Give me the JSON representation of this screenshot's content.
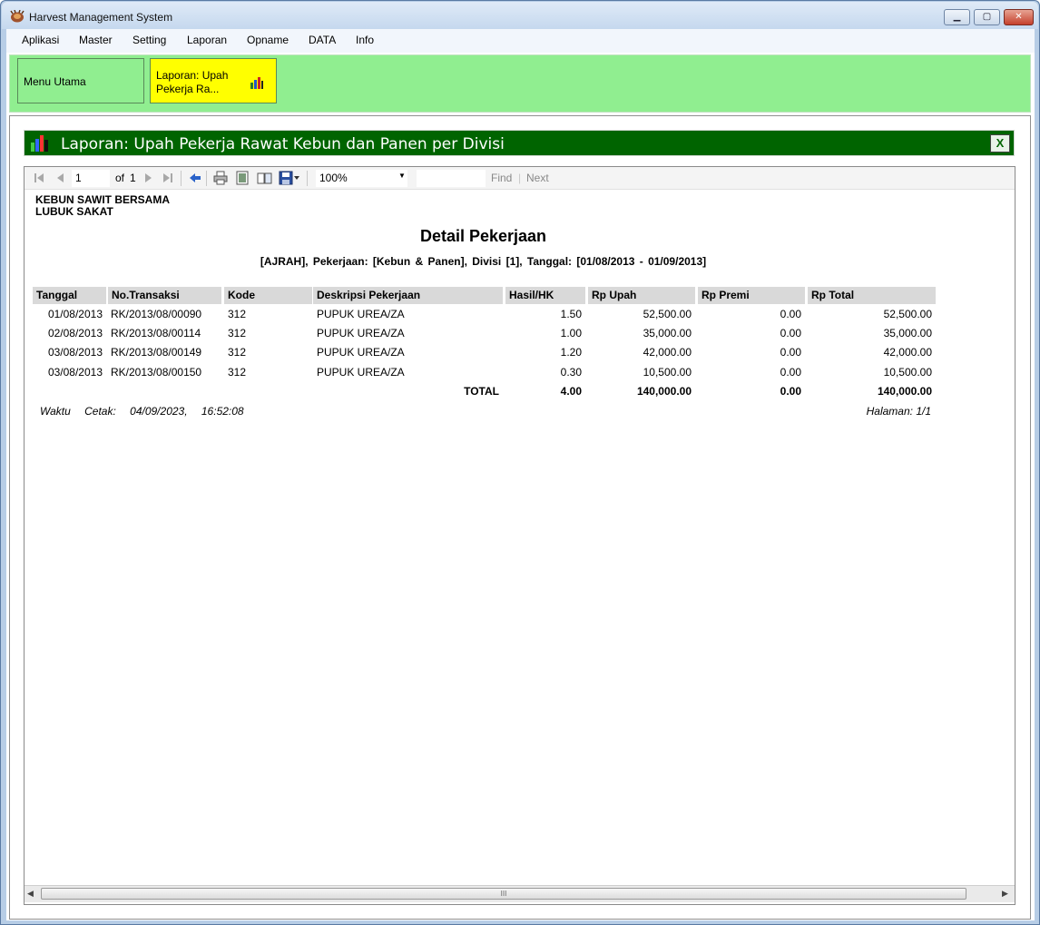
{
  "window": {
    "title": "Harvest Management System",
    "minimize_label": "▁",
    "maximize_label": "▢",
    "close_label": "✕"
  },
  "menu": [
    "Aplikasi",
    "Master",
    "Setting",
    "Laporan",
    "Opname",
    "DATA",
    "Info"
  ],
  "tabs": {
    "home": "Menu Utama",
    "report": "Laporan: Upah Pekerja Ra..."
  },
  "report_form": {
    "title": "Laporan: Upah Pekerja Rawat Kebun dan Panen per Divisi",
    "close_label": "X"
  },
  "toolbar": {
    "page": "1",
    "of_label": "of",
    "total_pages": "1",
    "zoom": "100%",
    "find_label": "Find",
    "next_label": "Next",
    "separator": "|"
  },
  "report": {
    "company": "KEBUN SAWIT BERSAMA",
    "location": "LUBUK SAKAT",
    "title": "Detail Pekerjaan",
    "subtitle": "[AJRAH], Pekerjaan: [Kebun & Panen], Divisi [1], Tanggal: [01/08/2013 - 01/09/2013]",
    "columns": [
      "Tanggal",
      "No.Transaksi",
      "Kode",
      "Deskripsi Pekerjaan",
      "Hasil/HK",
      "Rp Upah",
      "Rp Premi",
      "Rp Total"
    ],
    "rows": [
      [
        "01/08/2013",
        "RK/2013/08/00090",
        "312",
        "PUPUK UREA/ZA",
        "1.50",
        "52,500.00",
        "0.00",
        "52,500.00"
      ],
      [
        "02/08/2013",
        "RK/2013/08/00114",
        "312",
        "PUPUK UREA/ZA",
        "1.00",
        "35,000.00",
        "0.00",
        "35,000.00"
      ],
      [
        "03/08/2013",
        "RK/2013/08/00149",
        "312",
        "PUPUK UREA/ZA",
        "1.20",
        "42,000.00",
        "0.00",
        "42,000.00"
      ],
      [
        "03/08/2013",
        "RK/2013/08/00150",
        "312",
        "PUPUK UREA/ZA",
        "0.30",
        "10,500.00",
        "0.00",
        "10,500.00"
      ]
    ],
    "total": {
      "label": "TOTAL",
      "hasil": "4.00",
      "upah": "140,000.00",
      "premi": "0.00",
      "total": "140,000.00"
    },
    "print_time_label": "Waktu Cetak:",
    "print_time": "04/09/2023, 16:52:08",
    "page_label": "Halaman: 1/1"
  },
  "scrollbar": {
    "grip": "III"
  },
  "colors": {
    "header_green": "#006400",
    "tabstrip_green": "#90ee90",
    "active_tab_yellow": "#ffff00"
  }
}
